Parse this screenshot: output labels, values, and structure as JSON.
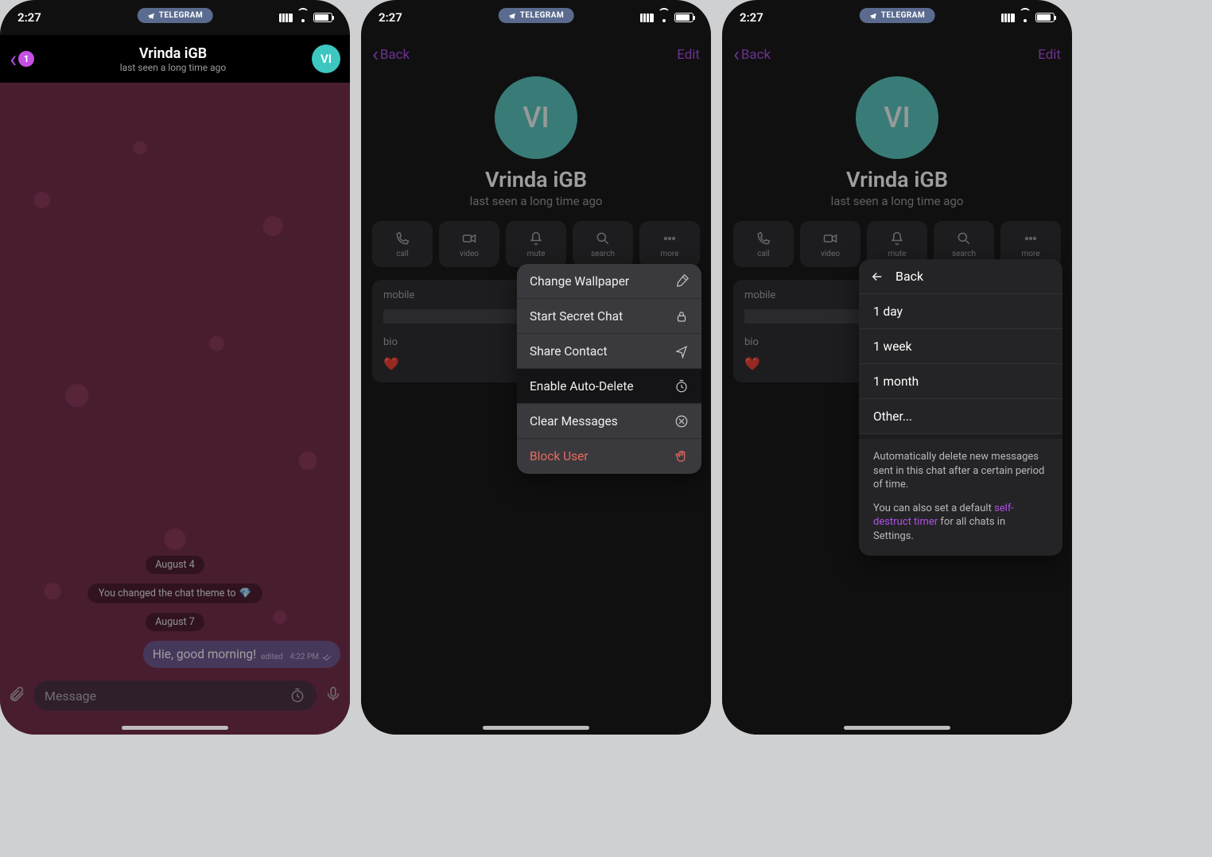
{
  "status": {
    "time": "2:27"
  },
  "telegram_pill": "TELEGRAM",
  "chat": {
    "back_badge": "1",
    "title": "Vrinda iGB",
    "subtitle": "last seen a long time ago",
    "avatar_initials": "VI",
    "date1": "August 4",
    "system_msg": "You changed the chat theme to",
    "system_emoji": "💎",
    "date2": "August 7",
    "out_msg": "Hie, good morning!",
    "out_meta_prefix": "edited",
    "out_meta_time": "4:22 PM",
    "input_placeholder": "Message"
  },
  "profile": {
    "back": "Back",
    "edit": "Edit",
    "name": "Vrinda iGB",
    "subtitle": "last seen a long time ago",
    "avatar_initials": "VI",
    "actions": {
      "call": "call",
      "video": "video",
      "mute": "mute",
      "search": "search",
      "more": "more"
    },
    "mobile_label": "mobile",
    "bio_label": "bio",
    "bio_value": "❤️"
  },
  "popup": {
    "wallpaper": "Change Wallpaper",
    "secret": "Start Secret Chat",
    "share": "Share Contact",
    "autodel": "Enable Auto-Delete",
    "clear": "Clear Messages",
    "block": "Block User"
  },
  "sheet": {
    "back": "Back",
    "opt1": "1 day",
    "opt2": "1 week",
    "opt3": "1 month",
    "opt4": "Other...",
    "foot1": "Automatically delete new messages sent in this chat after a certain period of time.",
    "foot2a": "You can also set a default ",
    "foot2link": "self-destruct timer",
    "foot2b": " for all chats in Settings."
  }
}
